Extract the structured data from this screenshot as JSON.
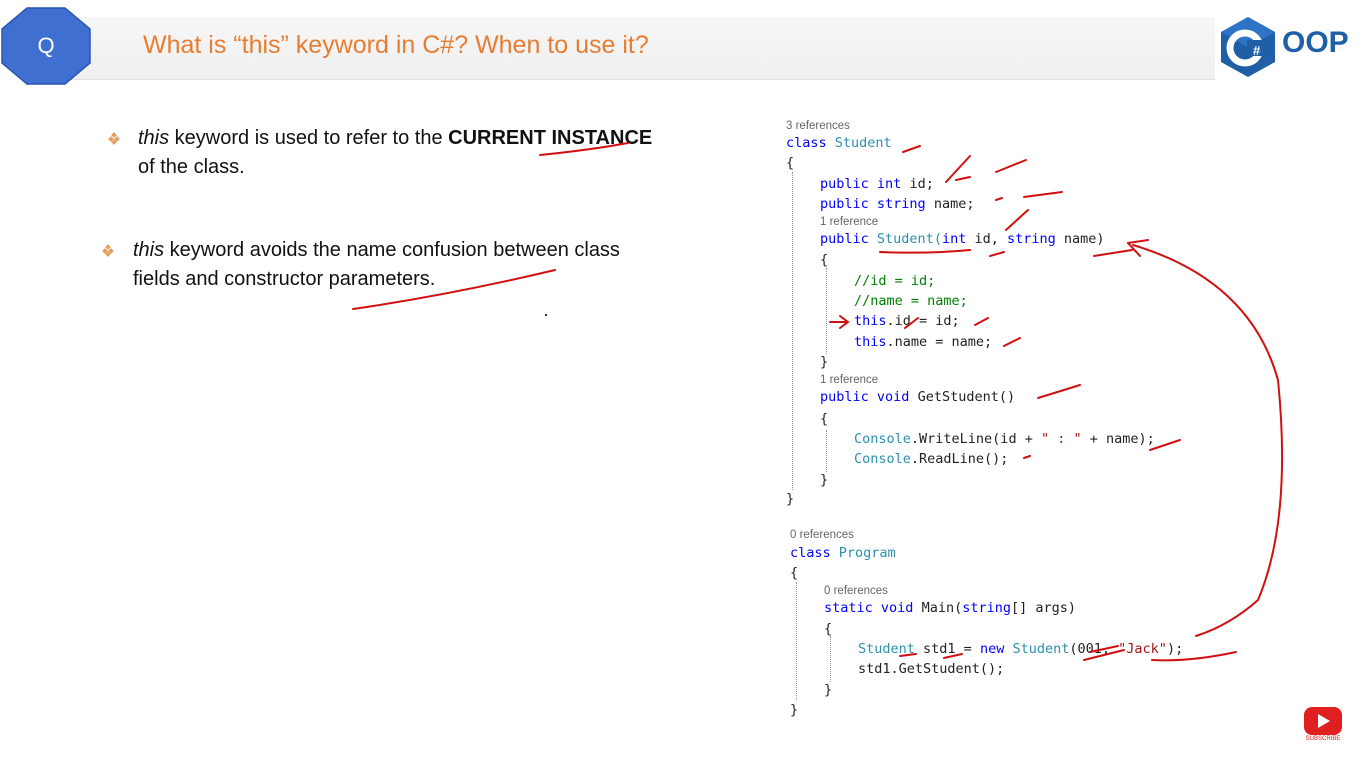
{
  "header": {
    "badge_letter": "Q",
    "title": "What is “this” keyword in C#? When to use it?",
    "logo_text": "OOP"
  },
  "bullets": [
    {
      "italic": "this",
      "text_a": " keyword is used to refer to the ",
      "bold": "CURRENT INSTANCE",
      "text_b": "of the class."
    },
    {
      "italic": "this",
      "text_a": " keyword avoids the name confusion between class",
      "text_b": "fields and constructor parameters."
    }
  ],
  "code": {
    "refs_student_class": "3 references",
    "refs_ctor": "1 reference",
    "refs_getstudent": "1 reference",
    "refs_program": "0 references",
    "refs_main": "0 references",
    "l_class_student_kw": "class",
    "l_class_student_name": "Student",
    "l_open1": "{",
    "l_id_public": "public",
    "l_id_int": "int",
    "l_id_rest": "id;",
    "l_name_public": "public",
    "l_name_string": "string",
    "l_name_rest": "name;",
    "l_ctor_public": "public",
    "l_ctor_name": "Student(",
    "l_ctor_int": "int",
    "l_ctor_mid": " id, ",
    "l_ctor_string": "string",
    "l_ctor_end": " name)",
    "l_open2": "{",
    "l_c1": "//id = id;",
    "l_c2": "//name = name;",
    "l_this1_kw": "this",
    "l_this1_rest": ".id = id;",
    "l_this2_kw": "this",
    "l_this2_rest": ".name = name;",
    "l_close2": "}",
    "l_gs_public": "public",
    "l_gs_void": "void",
    "l_gs_rest": " GetStudent()",
    "l_open3": "{",
    "l_wl_console": "Console",
    "l_wl_mid": ".WriteLine(id + ",
    "l_wl_str": "\" : \"",
    "l_wl_end": " + name);",
    "l_rl_console": "Console",
    "l_rl_rest": ".ReadLine();",
    "l_close3": "}",
    "l_close1": "}",
    "l_class_program_kw": "class",
    "l_class_program_name": "Program",
    "l_open4": "{",
    "l_main_static": "static",
    "l_main_void": "void",
    "l_main_rest1": " Main(",
    "l_main_string": "string",
    "l_main_rest2": "[] args)",
    "l_open5": "{",
    "l_new_type": "Student",
    "l_new_mid": " std1 = ",
    "l_new_kw": "new",
    "l_new_type2": "Student",
    "l_new_args": "(001, ",
    "l_new_str": "\"Jack\"",
    "l_new_end": ");",
    "l_call": "std1.GetStudent();",
    "l_close5": "}",
    "l_close4": "}"
  },
  "youtube": {
    "label": "SUBSCRIBE"
  },
  "colors": {
    "accent_orange": "#e67d32",
    "badge_blue": "#3f6fd1",
    "logo_blue": "#1f5fa8",
    "ink_red": "#d01010"
  }
}
